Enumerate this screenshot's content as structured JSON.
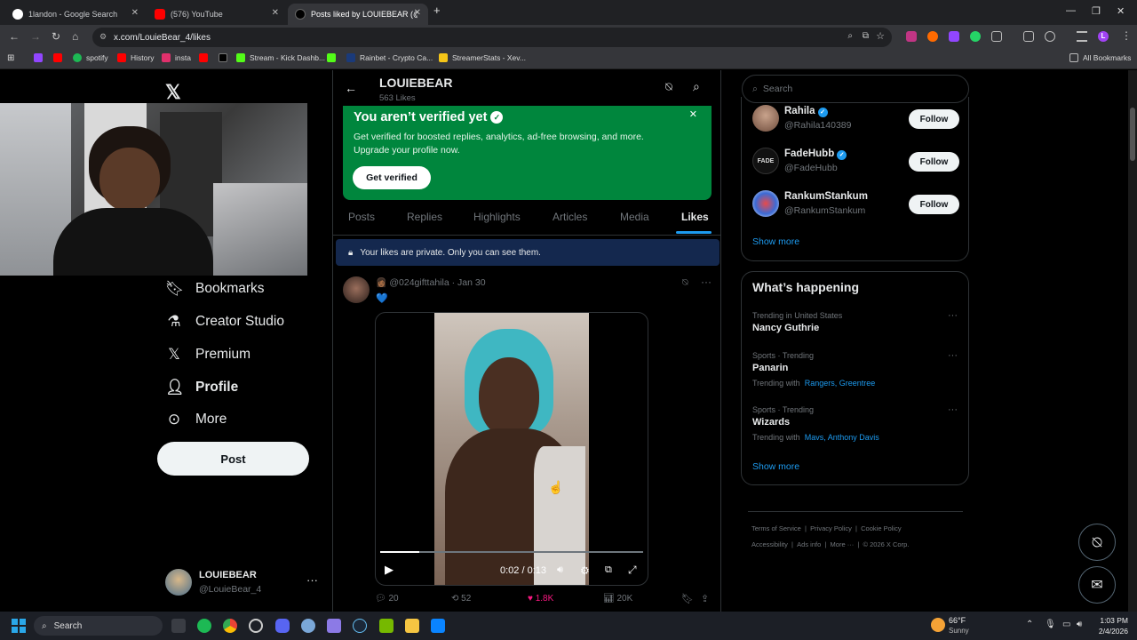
{
  "browser": {
    "tabs": [
      {
        "title": "1landon - Google Search",
        "active": false
      },
      {
        "title": "(576) YouTube",
        "active": false
      },
      {
        "title": "Posts liked by LOUIEBEAR (@Lo",
        "active": true
      }
    ],
    "new_tab": "+",
    "url": "x.com/LouieBear_4/likes",
    "bookmarks": [
      "spotify",
      "History",
      "insta",
      "Stream - Kick Dashb...",
      "Rainbet - Crypto Ca...",
      "StreamerStats - Xev..."
    ],
    "all_bookmarks": "All Bookmarks",
    "profile_initial": "L"
  },
  "sidebar": {
    "items": [
      {
        "label": "Bookmarks",
        "icon": "bookmark-icon"
      },
      {
        "label": "Creator Studio",
        "icon": "flask-icon"
      },
      {
        "label": "Premium",
        "icon": "x-logo-icon"
      },
      {
        "label": "Profile",
        "icon": "person-icon"
      },
      {
        "label": "More",
        "icon": "more-circle-icon"
      }
    ],
    "post_button": "Post",
    "account": {
      "name": "LOUIEBEAR",
      "handle": "@LouieBear_4"
    }
  },
  "header": {
    "name": "LOUIEBEAR",
    "likes_count": "563 Likes"
  },
  "verify_banner": {
    "title": "You aren’t verified yet",
    "body": "Get verified for boosted replies, analytics, ad-free browsing, and more. Upgrade your profile now.",
    "button": "Get verified"
  },
  "profile_tabs": [
    "Posts",
    "Replies",
    "Highlights",
    "Articles",
    "Media",
    "Likes"
  ],
  "private_notice": "Your likes are private. Only you can see them.",
  "tweet": {
    "handle": "@024gifttahila",
    "date": "Jan 30",
    "video_time": "0:02 / 0:13",
    "progress": 0.15,
    "replies": "20",
    "reposts": "52",
    "likes": "1.8K",
    "views": "20K"
  },
  "search": {
    "placeholder": "Search"
  },
  "who_to_follow": [
    {
      "name": "Rahila",
      "handle": "@Rahila140389",
      "verified": true
    },
    {
      "name": "FadeHubb",
      "handle": "@FadeHubb",
      "verified": true
    },
    {
      "name": "RankumStankum",
      "handle": "@RankumStankum",
      "verified": false
    }
  ],
  "follow_label": "Follow",
  "show_more": "Show more",
  "whats_happening": {
    "title": "What’s happening",
    "trends": [
      {
        "context": "Trending in United States",
        "name": "Nancy Guthrie",
        "with_label": "",
        "with": ""
      },
      {
        "context": "Sports · Trending",
        "name": "Panarin",
        "with_label": "Trending with",
        "with": "Rangers, Greentree"
      },
      {
        "context": "Sports · Trending",
        "name": "Wizards",
        "with_label": "Trending with",
        "with": "Mavs, Anthony Davis"
      }
    ]
  },
  "footer_links": [
    "Terms of Service",
    "Privacy Policy",
    "Cookie Policy",
    "Accessibility",
    "Ads info",
    "More ···",
    "© 2026 X Corp."
  ],
  "taskbar": {
    "search": "Search",
    "weather_temp": "66°F",
    "weather_cond": "Sunny",
    "time": "1:03 PM",
    "date": "2/4/2026"
  },
  "colors": {
    "x_blue": "#1d9bf0",
    "verify_green": "#00863d",
    "like_pink": "#f91880"
  }
}
